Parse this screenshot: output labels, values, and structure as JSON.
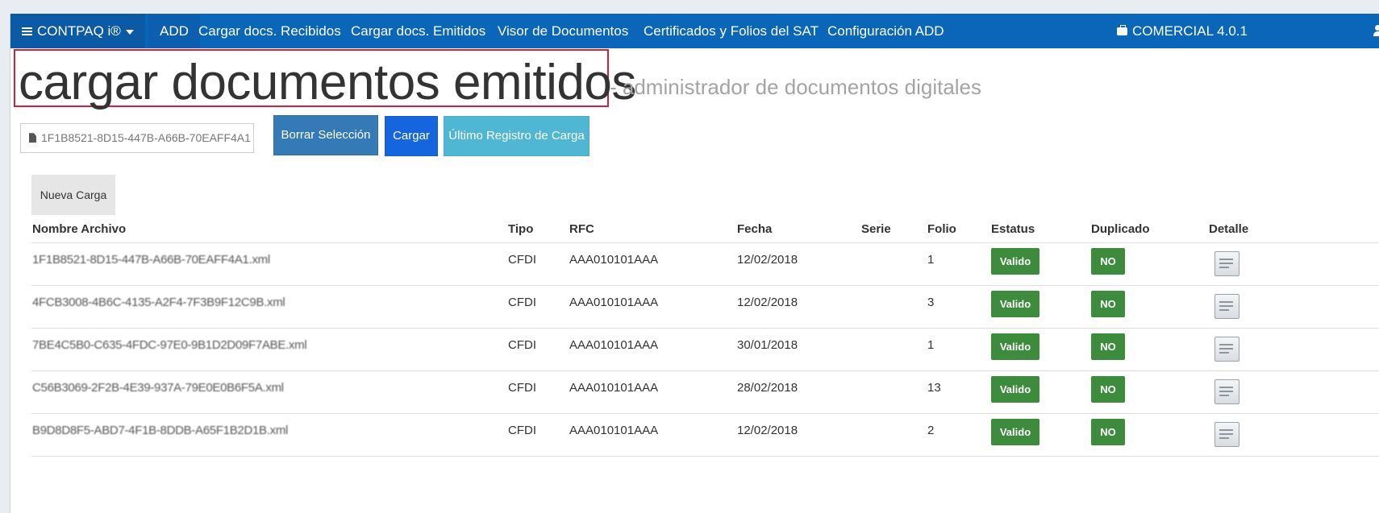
{
  "nav": {
    "brand": "CONTPAQ i®",
    "items": [
      "ADD",
      "Cargar docs. Recibidos",
      "Cargar docs. Emitidos",
      "Visor de Documentos",
      "Certificados y Folios del SAT",
      "Configuración ADD"
    ],
    "product": "COMERCIAL 4.0.1"
  },
  "header": {
    "title": "cargar documentos emitidos",
    "subtitle": "- administrador de documentos digitales"
  },
  "upload": {
    "file_name": "1F1B8521-8D15-447B-A66B-70EAFF4A1",
    "buttons": {
      "borrar": "Borrar Selección",
      "cargar": "Cargar",
      "ultimo": "Último Registro de Carga",
      "nueva": "Nueva Carga"
    }
  },
  "table": {
    "headers": [
      "Nombre Archivo",
      "Tipo",
      "RFC",
      "Fecha",
      "Serie",
      "Folio",
      "Estatus",
      "Duplicado",
      "Detalle"
    ],
    "rows": [
      {
        "nombre": "1F1B8521-8D15-447B-A66B-70EAFF4A1.xml",
        "tipo": "CFDI",
        "rfc": "AAA010101AAA",
        "fecha": "12/02/2018",
        "serie": "",
        "folio": "1",
        "estatus": "Valido",
        "duplicado": "NO"
      },
      {
        "nombre": "4FCB3008-4B6C-4135-A2F4-7F3B9F12C9B.xml",
        "tipo": "CFDI",
        "rfc": "AAA010101AAA",
        "fecha": "12/02/2018",
        "serie": "",
        "folio": "3",
        "estatus": "Valido",
        "duplicado": "NO"
      },
      {
        "nombre": "7BE4C5B0-C635-4FDC-97E0-9B1D2D09F7ABE.xml",
        "tipo": "CFDI",
        "rfc": "AAA010101AAA",
        "fecha": "30/01/2018",
        "serie": "",
        "folio": "1",
        "estatus": "Valido",
        "duplicado": "NO"
      },
      {
        "nombre": "C56B3069-2F2B-4E39-937A-79E0E0B6F5A.xml",
        "tipo": "CFDI",
        "rfc": "AAA010101AAA",
        "fecha": "28/02/2018",
        "serie": "",
        "folio": "13",
        "estatus": "Valido",
        "duplicado": "NO"
      },
      {
        "nombre": "B9D8D8F5-ABD7-4F1B-8DDB-A65F1B2D1B.xml",
        "tipo": "CFDI",
        "rfc": "AAA010101AAA",
        "fecha": "12/02/2018",
        "serie": "",
        "folio": "2",
        "estatus": "Valido",
        "duplicado": "NO"
      }
    ]
  },
  "colors": {
    "navbar": "#0a66b8",
    "title_highlight": "#d0223f",
    "badge_green": "#3d8b3d",
    "btn_primary": "#337ab7",
    "btn_info": "#4fb6d3"
  }
}
